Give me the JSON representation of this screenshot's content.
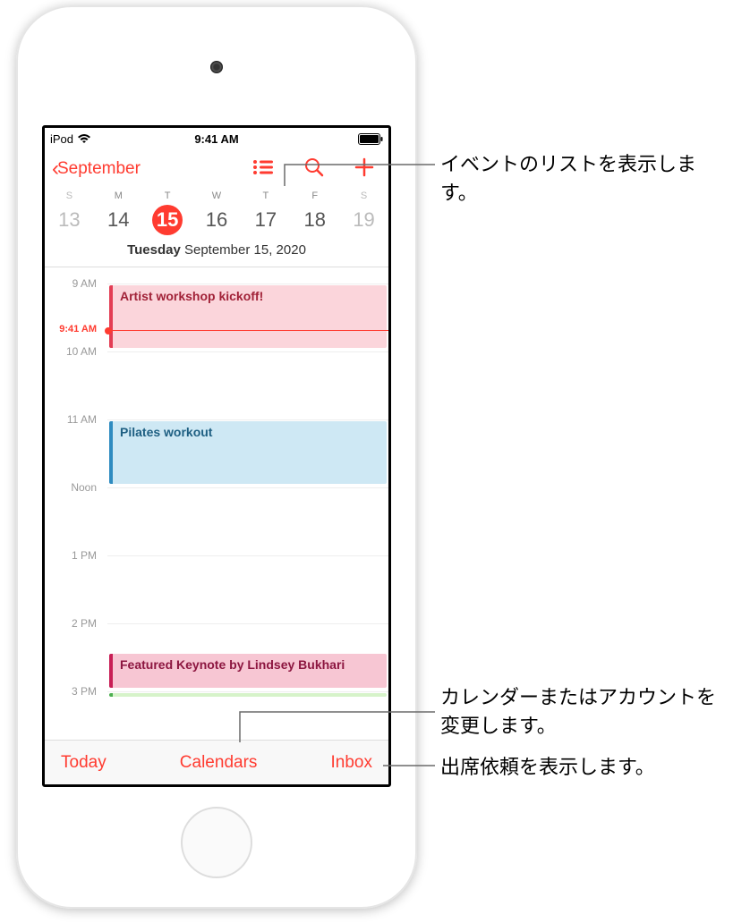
{
  "status": {
    "carrier": "iPod",
    "time": "9:41 AM"
  },
  "nav": {
    "back_label": "September"
  },
  "week": {
    "letters": [
      "S",
      "M",
      "T",
      "W",
      "T",
      "F",
      "S"
    ],
    "days": [
      {
        "num": "13",
        "weekend": true,
        "selected": false
      },
      {
        "num": "14",
        "weekend": false,
        "selected": false
      },
      {
        "num": "15",
        "weekend": false,
        "selected": true
      },
      {
        "num": "16",
        "weekend": false,
        "selected": false
      },
      {
        "num": "17",
        "weekend": false,
        "selected": false
      },
      {
        "num": "18",
        "weekend": false,
        "selected": false
      },
      {
        "num": "19",
        "weekend": true,
        "selected": false
      }
    ]
  },
  "date_heading": {
    "dow": "Tuesday",
    "rest": "  September 15, 2020"
  },
  "hours": [
    "9 AM",
    "10 AM",
    "11 AM",
    "Noon",
    "1 PM",
    "2 PM",
    "3 PM"
  ],
  "now": {
    "label": "9:41 AM"
  },
  "events": [
    {
      "title": "Artist workshop kickoff!",
      "cls": "ev-pink"
    },
    {
      "title": "Pilates workout",
      "cls": "ev-blue"
    },
    {
      "title": "Featured Keynote by Lindsey Bukhari",
      "cls": "ev-rose"
    }
  ],
  "toolbar": {
    "today": "Today",
    "calendars": "Calendars",
    "inbox": "Inbox"
  },
  "callouts": {
    "list": "イベントのリストを表示します。",
    "calendars": "カレンダーまたはアカウントを変更します。",
    "inbox": "出席依頼を表示します。"
  }
}
